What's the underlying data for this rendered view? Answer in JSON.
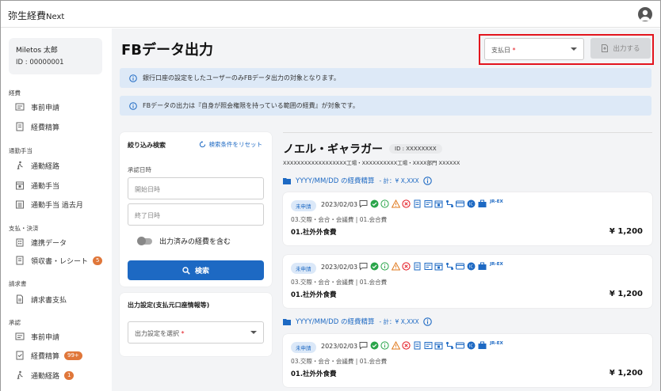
{
  "app": {
    "brand": "弥生経費",
    "brand_suffix": "Next"
  },
  "user": {
    "name": "Miletos 太郎",
    "id": "ID : 00000001"
  },
  "sidebar": {
    "sections": [
      {
        "label": "経費",
        "items": [
          {
            "label": "事前申請"
          },
          {
            "label": "経費精算"
          }
        ]
      },
      {
        "label": "通勤手当",
        "items": [
          {
            "label": "通勤経路"
          },
          {
            "label": "通勤手当"
          },
          {
            "label": "通勤手当 過去月"
          }
        ]
      },
      {
        "label": "支払・決済",
        "items": [
          {
            "label": "連携データ"
          },
          {
            "label": "領収書・レシート",
            "badge": "5"
          }
        ]
      },
      {
        "label": "請求書",
        "items": [
          {
            "label": "請求書支払"
          }
        ]
      },
      {
        "label": "承認",
        "items": [
          {
            "label": "事前申請"
          },
          {
            "label": "経費精算",
            "badge": "99+"
          },
          {
            "label": "通勤経路",
            "badge": "1"
          }
        ]
      }
    ]
  },
  "page": {
    "title": "FBデータ出力",
    "payment_date_label": "支払日",
    "required_mark": "*",
    "export_label": "出力する"
  },
  "notices": [
    "銀行口座の設定をしたユーザーのみFBデータ出力の対象となります。",
    "FBデータの出力は『自身が照会権限を持っている範囲の経費』が対象です。"
  ],
  "filter": {
    "title": "絞り込み検索",
    "reset_label": "検索条件をリセット",
    "approval_date_label": "承認日時",
    "start_placeholder": "開始日時",
    "end_placeholder": "終了日時",
    "include_exported_label": "出力済みの経費を含む",
    "search_label": "検索"
  },
  "output": {
    "title": "出力設定(支払元口座情報等)",
    "select_placeholder": "出力設定を選択"
  },
  "person": {
    "name": "ノエル・ギャラガー",
    "id": "ID : XXXXXXXX",
    "dept": "XXXXXXXXXXXXXXXXXX工場・XXXXXXXXXX工場・XXXX部門 XXXXXX"
  },
  "groups": [
    {
      "title": "YYYY/MM/DD の経費精算",
      "total": "- 計：¥ X,XXX"
    },
    {
      "title": "YYYY/MM/DD の経費精算",
      "total": "- 計：¥ X,XXX"
    }
  ],
  "cards": [
    {
      "status": "未申請",
      "date": "2023/02/03",
      "category": "03.交際・会合・会議費 | 01.会合費",
      "item": "01.社外外食費",
      "amount": "¥ 1,200",
      "jr": "JR-EX"
    },
    {
      "status": "未申請",
      "date": "2023/02/03",
      "category": "03.交際・会合・会議費 | 01.会合費",
      "item": "01.社外外食費",
      "amount": "¥ 1,200",
      "jr": "JR-EX"
    },
    {
      "status": "未申請",
      "date": "2023/02/03",
      "category": "03.交際・会合・会議費 | 01.会合費",
      "item": "01.社外外食費",
      "amount": "¥ 1,200",
      "jr": "JR-EX"
    }
  ],
  "colors": {
    "primary": "#1d69c3",
    "highlight": "#e3141d",
    "badge": "#e0773a",
    "notice_bg": "#dde9f7"
  }
}
